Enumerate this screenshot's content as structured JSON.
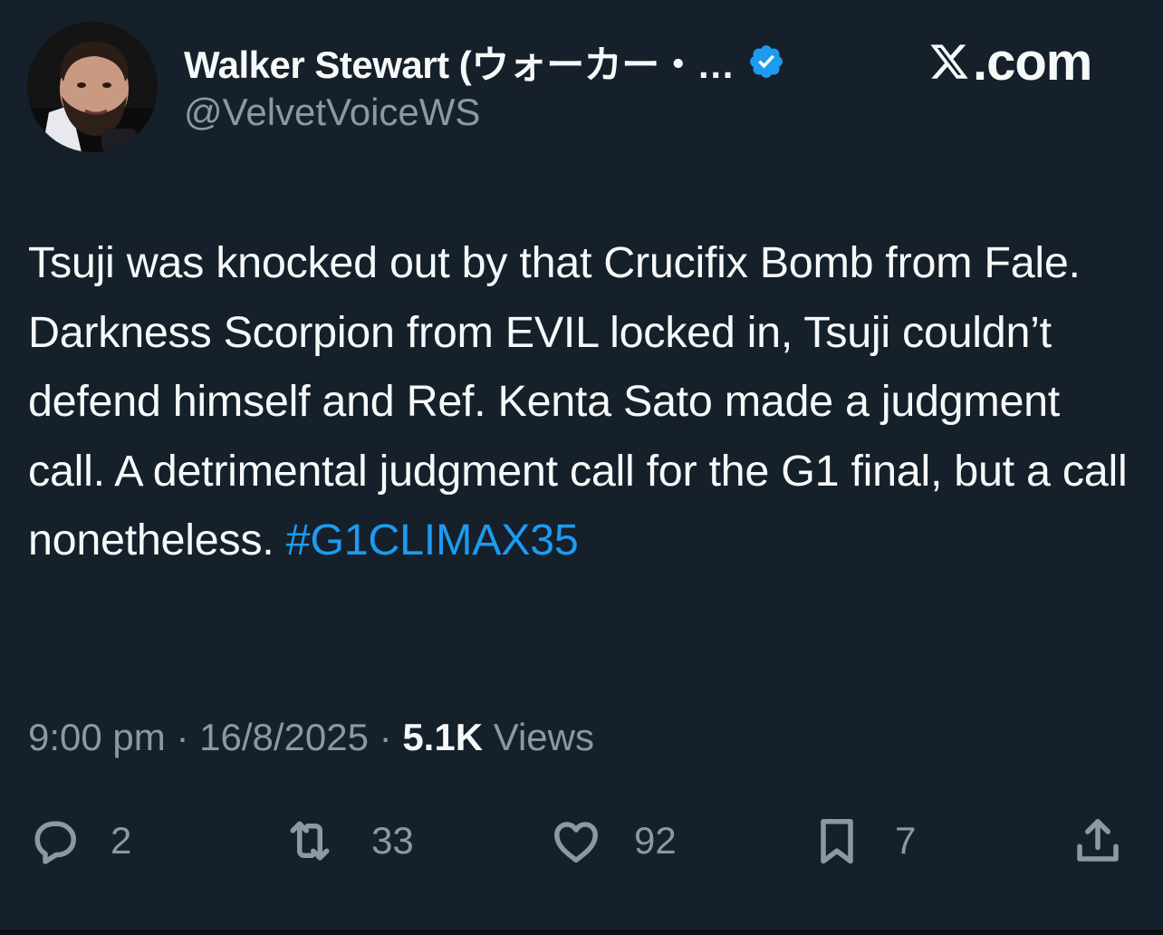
{
  "post": {
    "author": {
      "display_name": "Walker Stewart (ウォーカー・…",
      "handle": "@VelvetVoiceWS",
      "verified": true
    },
    "watermark": "X.com",
    "text": "Tsuji was knocked out by that Crucifix Bomb from Fale. Darkness Scorpion from EVIL locked in, Tsuji couldn’t defend himself and Ref. Kenta Sato made a judgment call. A detrimental judgment call for the G1 final, but a call nonetheless.",
    "hashtag": "#G1CLIMAX35",
    "time": "9:00 pm",
    "date": "16/8/2025",
    "views_count": "5.1K",
    "views_label": "Views",
    "separator": "·"
  },
  "actions": {
    "replies": "2",
    "reposts": "33",
    "likes": "92",
    "bookmarks": "7"
  },
  "colors": {
    "background": "#15202b",
    "text": "#f7f9f9",
    "secondary": "#8b98a5",
    "accent": "#1d9bf0"
  },
  "icons": [
    "verified-badge-icon",
    "x-logo-icon",
    "reply-icon",
    "repost-icon",
    "like-icon",
    "bookmark-icon",
    "share-icon"
  ]
}
